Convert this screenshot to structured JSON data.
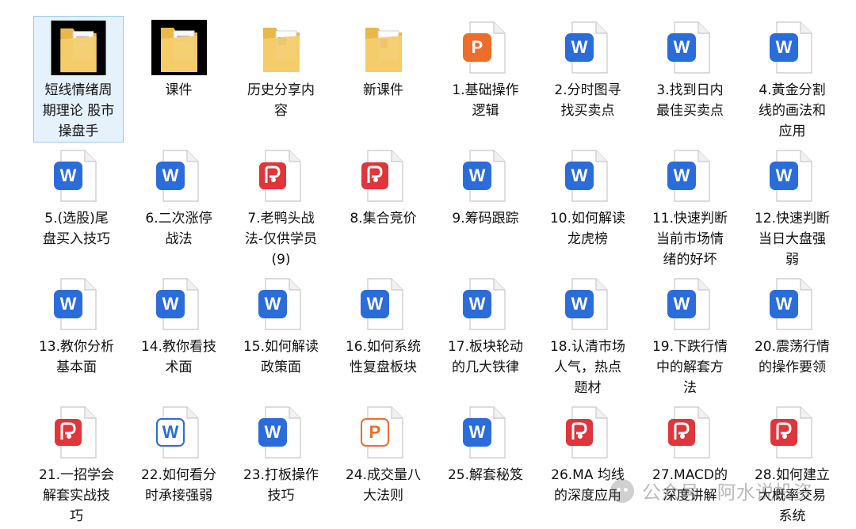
{
  "files": [
    {
      "label": "短线情绪周期理论 股市操盘手",
      "icon": "folder-with-preview-icon",
      "kind": "folder-dark",
      "selected": true
    },
    {
      "label": "课件",
      "icon": "folder-with-preview-icon",
      "kind": "folder-dark"
    },
    {
      "label": "历史分享内容",
      "icon": "folder-icon",
      "kind": "folder-doc"
    },
    {
      "label": "新课件",
      "icon": "folder-icon",
      "kind": "folder-pdf"
    },
    {
      "label": "1.基础操作逻辑",
      "icon": "powerpoint-file-icon",
      "kind": "ppt"
    },
    {
      "label": "2.分时图寻找买卖点",
      "icon": "word-file-icon",
      "kind": "word"
    },
    {
      "label": "3.找到日内最佳买卖点",
      "icon": "word-file-icon",
      "kind": "word"
    },
    {
      "label": "4.黃金分割线的画法和应用",
      "icon": "word-file-icon",
      "kind": "word"
    },
    {
      "label": "5.(选股)尾盘买入技巧",
      "icon": "word-file-icon",
      "kind": "word"
    },
    {
      "label": "6.二次涨停战法",
      "icon": "word-file-icon",
      "kind": "word"
    },
    {
      "label": "7.老鸭头战法-仅供学员(9)",
      "icon": "pdf-file-icon",
      "kind": "pdf"
    },
    {
      "label": "8.集合竞价",
      "icon": "pdf-file-icon",
      "kind": "pdf"
    },
    {
      "label": "9.筹码跟踪",
      "icon": "word-file-icon",
      "kind": "word"
    },
    {
      "label": "10.如何解读龙虎榜",
      "icon": "word-file-icon",
      "kind": "word"
    },
    {
      "label": "11.快速判断当前市场情绪的好坏",
      "icon": "word-file-icon",
      "kind": "word"
    },
    {
      "label": "12.快速判断当日大盘强弱",
      "icon": "word-file-icon",
      "kind": "word"
    },
    {
      "label": "13.教你分析基本面",
      "icon": "word-file-icon",
      "kind": "word"
    },
    {
      "label": "14.教你看技术面",
      "icon": "word-file-icon",
      "kind": "word"
    },
    {
      "label": "15.如何解读政策面",
      "icon": "word-file-icon",
      "kind": "word"
    },
    {
      "label": "16.如何系统性复盘板块",
      "icon": "word-file-icon",
      "kind": "word"
    },
    {
      "label": "17.板块轮动的几大铁律",
      "icon": "word-file-icon",
      "kind": "word"
    },
    {
      "label": "18.认清市场人气，热点题材",
      "icon": "word-file-icon",
      "kind": "word"
    },
    {
      "label": "19.下跌行情中的解套方法",
      "icon": "word-file-icon",
      "kind": "word"
    },
    {
      "label": "20.震荡行情 的操作要领",
      "icon": "word-file-icon",
      "kind": "word"
    },
    {
      "label": "21.一招学会解套实战技巧",
      "icon": "pdf-file-icon",
      "kind": "pdf"
    },
    {
      "label": "22.如何看分时承接强弱",
      "icon": "word-file-icon",
      "kind": "word-outline"
    },
    {
      "label": "23.打板操作技巧",
      "icon": "word-file-icon",
      "kind": "word"
    },
    {
      "label": "24.成交量八大法则",
      "icon": "powerpoint-file-icon",
      "kind": "ppt-outline"
    },
    {
      "label": "25.解套秘笈",
      "icon": "word-file-icon",
      "kind": "word"
    },
    {
      "label": "26.MA 均线的深度应用",
      "icon": "pdf-file-icon",
      "kind": "pdf"
    },
    {
      "label": "27.MACD的深度讲解",
      "icon": "pdf-file-icon",
      "kind": "pdf"
    },
    {
      "label": "28.如何建立大概率交易系统",
      "icon": "pdf-file-icon",
      "kind": "pdf"
    }
  ],
  "watermark": {
    "text": "公众号 · 阿水说投资",
    "icon": "wechat-icon"
  },
  "colors": {
    "word": "#2b6cdb",
    "pdf": "#e0353a",
    "ppt": "#ef6d2a",
    "folder": "#f2c25a",
    "selection": "#e5f1fb"
  }
}
